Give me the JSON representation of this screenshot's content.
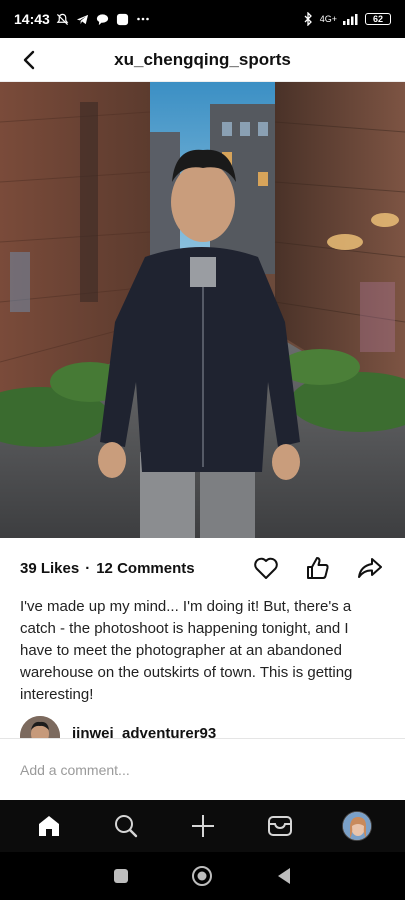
{
  "status_bar": {
    "time": "14:43",
    "network": "4G+",
    "battery": "62",
    "left_icons": [
      "mute-icon",
      "telegram-icon",
      "chat-icon",
      "app-icon",
      "more-dots-icon"
    ],
    "right_icons": [
      "bluetooth-icon",
      "signal-icon",
      "battery-icon"
    ]
  },
  "header": {
    "title": "xu_chengqing_sports",
    "back_icon": "back-arrow-icon"
  },
  "post": {
    "likes_label": "39 Likes",
    "separator": "·",
    "comments_label": "12 Comments",
    "action_icons": [
      "heart-icon",
      "thumbs-up-icon",
      "share-icon"
    ],
    "caption": "I've made up my mind... I'm doing it! But, there's a catch - the photoshoot is happening tonight, and I have to meet the photographer at an abandoned warehouse on the outskirts of town. This is getting interesting!"
  },
  "comment_preview": {
    "username": "jinwei_adventurer93"
  },
  "comment_input": {
    "placeholder": "Add a comment..."
  },
  "bottom_nav": {
    "items": [
      "home-icon",
      "search-icon",
      "plus-icon",
      "inbox-icon",
      "profile-avatar"
    ]
  },
  "system_nav": {
    "items": [
      "recents-square-icon",
      "home-circle-icon",
      "back-triangle-icon"
    ]
  },
  "colors": {
    "status_bg": "#000000",
    "nav_bg": "#0c0c0c",
    "text": "#111111",
    "placeholder": "#9a9a9a"
  }
}
